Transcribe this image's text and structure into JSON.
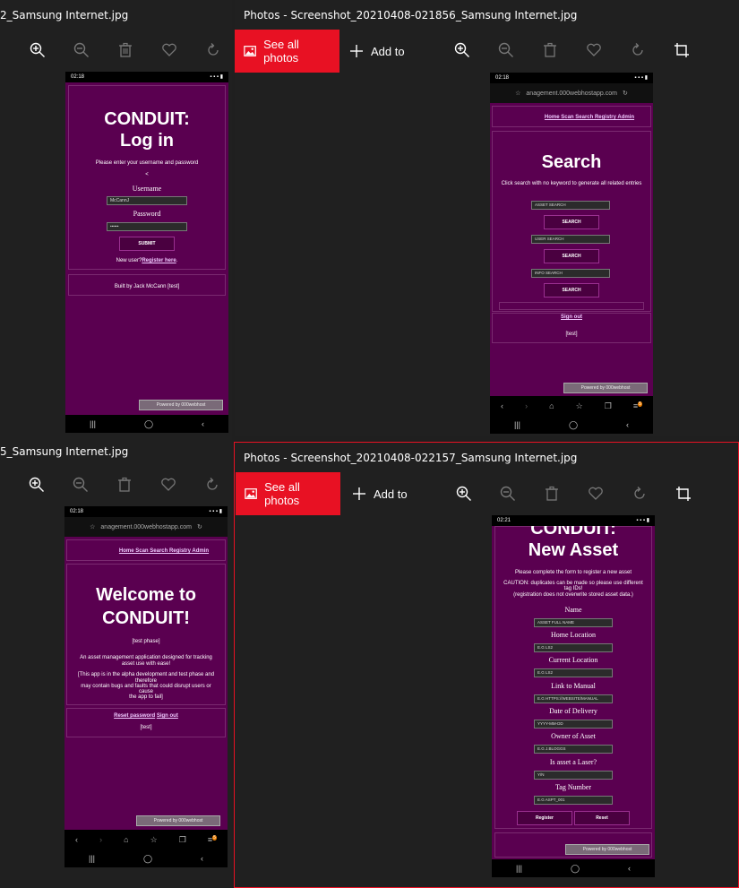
{
  "windows": {
    "top_left": {
      "title": "2_Samsung Internet.jpg"
    },
    "top_right": {
      "title": "Photos - Screenshot_20210408-021856_Samsung Internet.jpg"
    },
    "bottom_left": {
      "title": "5_Samsung Internet.jpg"
    },
    "bottom_right": {
      "title": "Photos - Screenshot_20210408-022157_Samsung Internet.jpg"
    }
  },
  "toolbar": {
    "see_all_label": "See all photos",
    "add_to_label": "Add to"
  },
  "login": {
    "time": "02:18",
    "title1": "CONDUIT:",
    "title2": "Log in",
    "subtitle": "Please enter your username and password",
    "lt": "<",
    "username_label": "Username",
    "username_value": "McCannJ",
    "password_label": "Password",
    "password_value": "••••••",
    "submit": "SUBMIT",
    "new_user": "New user?",
    "register_here": "Register here",
    "footer": "Built by Jack McCann [test]",
    "powered": "Powered by 000webhost"
  },
  "search": {
    "time": "02:18",
    "url": "anagement.000webhostapp.com",
    "nav": "Home Scan Search Registry Admin",
    "title": "Search",
    "subtitle": "Click search with no keyword to generate all related entries",
    "asset_ph": "ASSET SEARCH",
    "user_ph": "USER SEARCH",
    "info_ph": "INFO SEARCH",
    "btn": "SEARCH",
    "sign_out": "Sign out",
    "test": "[test]",
    "powered": "Powered by 000webhost",
    "badge": "5"
  },
  "welcome": {
    "time": "02:18",
    "url": "anagement.000webhostapp.com",
    "nav": "Home Scan Search Registry Admin",
    "title1": "Welcome to",
    "title2": "CONDUIT!",
    "phase": "[test phase]",
    "desc1": "An asset management application designed for tracking",
    "desc2": "asset use with ease!",
    "desc3": "[This app is in the alpha development and test phase and",
    "desc4": "therefore",
    "desc5": "may contain bugs and faults that could disrupt users or",
    "desc6": "cause",
    "desc7": "the app to fail]",
    "reset": "Reset password",
    "sign_out": "Sign out",
    "test": "[test]",
    "powered": "Powered by 000webhost",
    "badge": "5"
  },
  "asset": {
    "time": "02:21",
    "title1": "CONDUIT:",
    "title2": "New Asset",
    "subtitle": "Please complete the form to register a new asset",
    "caution1": "CAUTION: duplicates can be made so please use different",
    "caution2": "tag IDs!",
    "caution3": "(registration does not overwrite stored asset data.)",
    "fields": [
      {
        "label": "Name",
        "ph": "ASSET FULL NAME"
      },
      {
        "label": "Home Location",
        "ph": "E.G LS2"
      },
      {
        "label": "Current Location",
        "ph": "E.G LS2"
      },
      {
        "label": "Link to Manual",
        "ph": "E.G HTTPS://WEBSITE/MANUAL"
      },
      {
        "label": "Date of Delivery",
        "ph": "YYYY-MM-DD"
      },
      {
        "label": "Owner of Asset",
        "ph": "E.G J.BLOGGS"
      },
      {
        "label": "Is asset a Laser?",
        "ph": "Y/N"
      },
      {
        "label": "Tag Number",
        "ph": "E.G ASPT_001"
      }
    ],
    "register": "Register",
    "reset": "Reset",
    "powered": "Powered by 000webhost"
  }
}
